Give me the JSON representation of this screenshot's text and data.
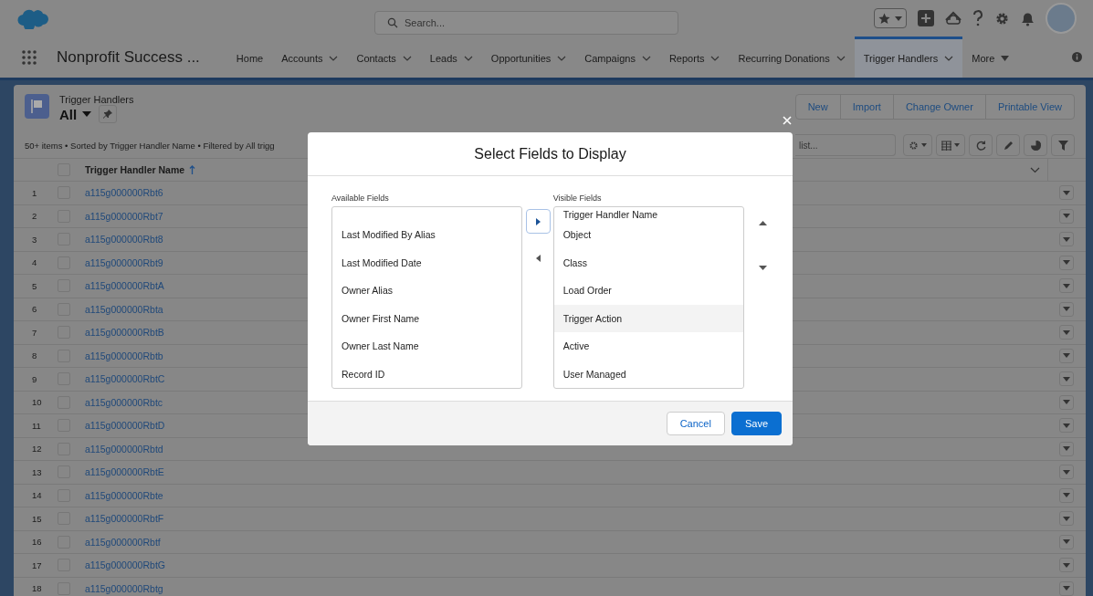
{
  "app": {
    "name": "Nonprofit Success ...",
    "search_placeholder": "Search..."
  },
  "nav": [
    {
      "label": "Home",
      "menu": false,
      "selected": false
    },
    {
      "label": "Accounts",
      "menu": true,
      "selected": false
    },
    {
      "label": "Contacts",
      "menu": true,
      "selected": false
    },
    {
      "label": "Leads",
      "menu": true,
      "selected": false
    },
    {
      "label": "Opportunities",
      "menu": true,
      "selected": false
    },
    {
      "label": "Campaigns",
      "menu": true,
      "selected": false
    },
    {
      "label": "Reports",
      "menu": true,
      "selected": false
    },
    {
      "label": "Recurring Donations",
      "menu": true,
      "selected": false
    },
    {
      "label": "Trigger Handlers",
      "menu": true,
      "selected": true
    }
  ],
  "more": "More",
  "list_view": {
    "object": "Trigger Handlers",
    "view": "All",
    "status": "50+ items • Sorted by Trigger Handler Name • Filtered by All trigg",
    "buttons": [
      "New",
      "Import",
      "Change Owner",
      "Printable View"
    ],
    "search_placeholder": "list...",
    "column": "Trigger Handler Name",
    "select_all_checked": false
  },
  "rows": [
    {
      "number": "1",
      "name": "a115g000000Rbt6",
      "checked": false
    },
    {
      "number": "2",
      "name": "a115g000000Rbt7",
      "checked": false
    },
    {
      "number": "3",
      "name": "a115g000000Rbt8",
      "checked": false
    },
    {
      "number": "4",
      "name": "a115g000000Rbt9",
      "checked": false
    },
    {
      "number": "5",
      "name": "a115g000000RbtA",
      "checked": false
    },
    {
      "number": "6",
      "name": "a115g000000Rbta",
      "checked": false
    },
    {
      "number": "7",
      "name": "a115g000000RbtB",
      "checked": false
    },
    {
      "number": "8",
      "name": "a115g000000Rbtb",
      "checked": false
    },
    {
      "number": "9",
      "name": "a115g000000RbtC",
      "checked": false
    },
    {
      "number": "10",
      "name": "a115g000000Rbtc",
      "checked": false
    },
    {
      "number": "11",
      "name": "a115g000000RbtD",
      "checked": false
    },
    {
      "number": "12",
      "name": "a115g000000Rbtd",
      "checked": false
    },
    {
      "number": "13",
      "name": "a115g000000RbtE",
      "checked": false
    },
    {
      "number": "14",
      "name": "a115g000000Rbte",
      "checked": false
    },
    {
      "number": "15",
      "name": "a115g000000RbtF",
      "checked": false
    },
    {
      "number": "16",
      "name": "a115g000000Rbtf",
      "checked": false
    },
    {
      "number": "17",
      "name": "a115g000000RbtG",
      "checked": false
    },
    {
      "number": "18",
      "name": "a115g000000Rbtg",
      "checked": false
    }
  ],
  "modal": {
    "title": "Select Fields to Display",
    "available_label": "Available Fields",
    "available": [
      "Last Modified By Alias",
      "Last Modified Date",
      "Owner Alias",
      "Owner First Name",
      "Owner Last Name",
      "Record ID"
    ],
    "visible_label": "Visible Fields",
    "visible": [
      {
        "label": "Trigger Handler Name",
        "selected": false
      },
      {
        "label": "Object",
        "selected": false
      },
      {
        "label": "Class",
        "selected": false
      },
      {
        "label": "Load Order",
        "selected": false
      },
      {
        "label": "Trigger Action",
        "selected": true
      },
      {
        "label": "Active",
        "selected": false
      },
      {
        "label": "User Managed",
        "selected": false
      }
    ],
    "cancel": "Cancel",
    "save": "Save"
  }
}
